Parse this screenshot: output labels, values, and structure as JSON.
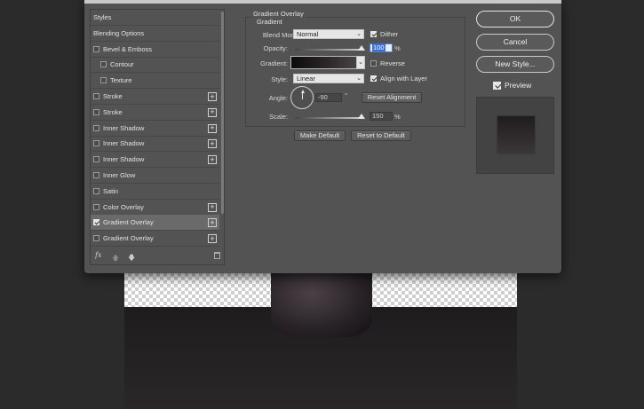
{
  "styles_panel": {
    "items": [
      {
        "label": "Styles",
        "checkbox": false,
        "checked": false,
        "indent": 0,
        "plus": false,
        "selected": false
      },
      {
        "label": "Blending Options",
        "checkbox": false,
        "checked": false,
        "indent": 0,
        "plus": false,
        "selected": false
      },
      {
        "label": "Bevel & Emboss",
        "checkbox": true,
        "checked": false,
        "indent": 0,
        "plus": false,
        "selected": false
      },
      {
        "label": "Contour",
        "checkbox": true,
        "checked": false,
        "indent": 1,
        "plus": false,
        "selected": false
      },
      {
        "label": "Texture",
        "checkbox": true,
        "checked": false,
        "indent": 1,
        "plus": false,
        "selected": false
      },
      {
        "label": "Stroke",
        "checkbox": true,
        "checked": false,
        "indent": 0,
        "plus": true,
        "selected": false
      },
      {
        "label": "Stroke",
        "checkbox": true,
        "checked": false,
        "indent": 0,
        "plus": true,
        "selected": false
      },
      {
        "label": "Inner Shadow",
        "checkbox": true,
        "checked": false,
        "indent": 0,
        "plus": true,
        "selected": false
      },
      {
        "label": "Inner Shadow",
        "checkbox": true,
        "checked": false,
        "indent": 0,
        "plus": true,
        "selected": false
      },
      {
        "label": "Inner Shadow",
        "checkbox": true,
        "checked": false,
        "indent": 0,
        "plus": true,
        "selected": false
      },
      {
        "label": "Inner Glow",
        "checkbox": true,
        "checked": false,
        "indent": 0,
        "plus": false,
        "selected": false
      },
      {
        "label": "Satin",
        "checkbox": true,
        "checked": false,
        "indent": 0,
        "plus": false,
        "selected": false
      },
      {
        "label": "Color Overlay",
        "checkbox": true,
        "checked": false,
        "indent": 0,
        "plus": true,
        "selected": false
      },
      {
        "label": "Gradient Overlay",
        "checkbox": true,
        "checked": true,
        "indent": 0,
        "plus": true,
        "selected": true
      },
      {
        "label": "Gradient Overlay",
        "checkbox": true,
        "checked": false,
        "indent": 0,
        "plus": true,
        "selected": false
      }
    ],
    "footer": {
      "fx_label": "fx",
      "up_arrow": "🡅",
      "down_arrow": "🡇"
    }
  },
  "gradient_overlay": {
    "title": "Gradient Overlay",
    "subtitle": "Gradient",
    "blend_mode_label": "Blend Mode:",
    "blend_mode_value": "Normal",
    "dither_label": "Dither",
    "dither_checked": true,
    "opacity_label": "Opacity:",
    "opacity_value": "100",
    "opacity_fraction": 1.0,
    "percent_unit": "%",
    "gradient_label": "Gradient:",
    "reverse_label": "Reverse",
    "reverse_checked": false,
    "style_label": "Style:",
    "style_value": "Linear",
    "align_label": "Align with Layer",
    "align_checked": true,
    "angle_label": "Angle:",
    "angle_value": "-90",
    "degree_unit": "°",
    "reset_alignment_label": "Reset Alignment",
    "scale_label": "Scale:",
    "scale_value": "150",
    "scale_fraction": 1.0,
    "make_default_label": "Make Default",
    "reset_default_label": "Reset to Default"
  },
  "actions": {
    "ok_label": "OK",
    "cancel_label": "Cancel",
    "new_style_label": "New Style...",
    "preview_label": "Preview",
    "preview_checked": true
  },
  "colors": {
    "dialog_bg": "#535353",
    "selected_row": "#6a6a6a",
    "focus_blue": "#3b6fd6"
  }
}
